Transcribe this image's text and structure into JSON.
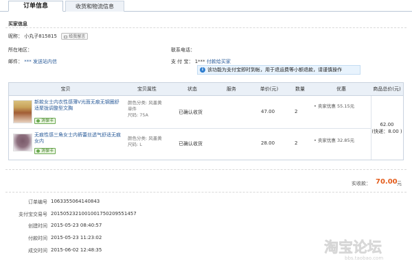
{
  "tabs": [
    {
      "label": "订单信息"
    },
    {
      "label": "收货和物流信息"
    }
  ],
  "buyer": {
    "section_title": "买家信息",
    "nickname_label": "昵称：",
    "nickname": "小丸子815815",
    "message_button": "给我留言",
    "region_label": "所在地区：",
    "region_value": "",
    "phone_label": "联系电话：",
    "phone_value": "",
    "email_label": "邮件：",
    "email_value": "*** 发送站内信",
    "alipay_label": "支 付 宝：",
    "alipay_value": "1***",
    "alipay_link": "付款给买家"
  },
  "notice": {
    "icon": "info-icon",
    "text": "该功能为支付宝即时到帐，用于退运费等小额退款，请谨慎操作"
  },
  "table": {
    "headers": [
      "宝贝",
      "宝贝属性",
      "状态",
      "服务",
      "单价(元)",
      "数量",
      "优惠",
      "商品总价(元)"
    ],
    "items": [
      {
        "name": "新款女士内衣性感薄V光面无痕无钢圈舒适聚拢调整型文胸",
        "badge": "消保卡",
        "attr_line1": "颜色分类: 风墨黄",
        "attr_line2": "单件",
        "attr_line3": "尺码: 75A",
        "status": "已确认收货",
        "service": "",
        "price": "47.00",
        "quantity": "2",
        "promo": "• 卖家优惠 55.15元"
      },
      {
        "name": "无痕性感三角女士内裤蕾丝透气舒适无痕女内",
        "badge": "消保卡",
        "attr_line1": "颜色分类: 风墨黄",
        "attr_line2": "尺码: L",
        "attr_line3": "",
        "status": "已确认收货",
        "service": "",
        "price": "28.00",
        "quantity": "2",
        "promo": "• 卖家优惠 32.85元"
      }
    ],
    "total_value": "62.00",
    "total_shipping": "(快递：8.00 )"
  },
  "payment": {
    "label": "实收款：",
    "value": "70.00",
    "unit": "元"
  },
  "order_info": [
    {
      "label": "订单编号",
      "value": "1063355064140843"
    },
    {
      "label": "支付宝交易号",
      "value": "2015052321001001750209551457"
    },
    {
      "label": "创建时间",
      "value": "2015-05-23 08:40:57"
    },
    {
      "label": "付款时间",
      "value": "2015-05-23 11:23:02"
    },
    {
      "label": "成交时间",
      "value": "2015-06-02 12:48:35"
    }
  ],
  "watermark": {
    "text": "淘宝论坛",
    "url": "bbs.taobao.com"
  },
  "colors": {
    "accent": "#e35b1a",
    "link": "#2b5c9a",
    "header_bg": "#eaf0f7",
    "notice_bg": "#e8f3fd"
  }
}
